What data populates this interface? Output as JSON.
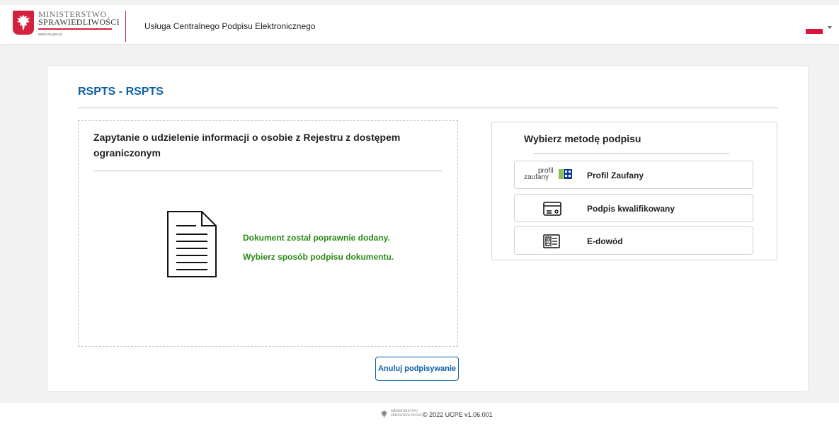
{
  "header": {
    "org_line1": "MINISTERSTWO",
    "org_line2": "SPRAWIEDLIWOŚCI",
    "org_url": "www.ms.gov.pl",
    "service_title": "Usługa Centralnego Podpisu Elektronicznego",
    "language_flag": "pl-flag",
    "colors": {
      "accent_red": "#d4213d"
    }
  },
  "main": {
    "page_title": "RSPTS - RSPTS",
    "document": {
      "title": "Zapytanie o udzielenie informacji o osobie z Rejestru z dostępem ograniczonym",
      "icon": "document-icon",
      "status_line1": "Dokument został poprawnie dodany.",
      "status_line2": "Wybierz sposób podpisu dokumentu.",
      "status_color": "#2a8a17"
    },
    "cancel_button": "Anuluj podpisywanie",
    "signature": {
      "title": "Wybierz metodę podpisu",
      "methods": [
        {
          "label": "Profil Zaufany",
          "icon": "profil-zaufany-logo",
          "logo_line1": "profil",
          "logo_line2": "zaufany"
        },
        {
          "label": "Podpis kwalifikowany",
          "icon": "card-icon"
        },
        {
          "label": "E-dowód",
          "icon": "id-card-icon"
        }
      ]
    },
    "colors": {
      "title_blue": "#0b5ea8"
    }
  },
  "footer": {
    "org_line1": "MINISTERSTWO",
    "org_line2": "SPRAWIEDLIWOŚCI",
    "copyright": "© 2022 UCPE v1.06.001"
  }
}
